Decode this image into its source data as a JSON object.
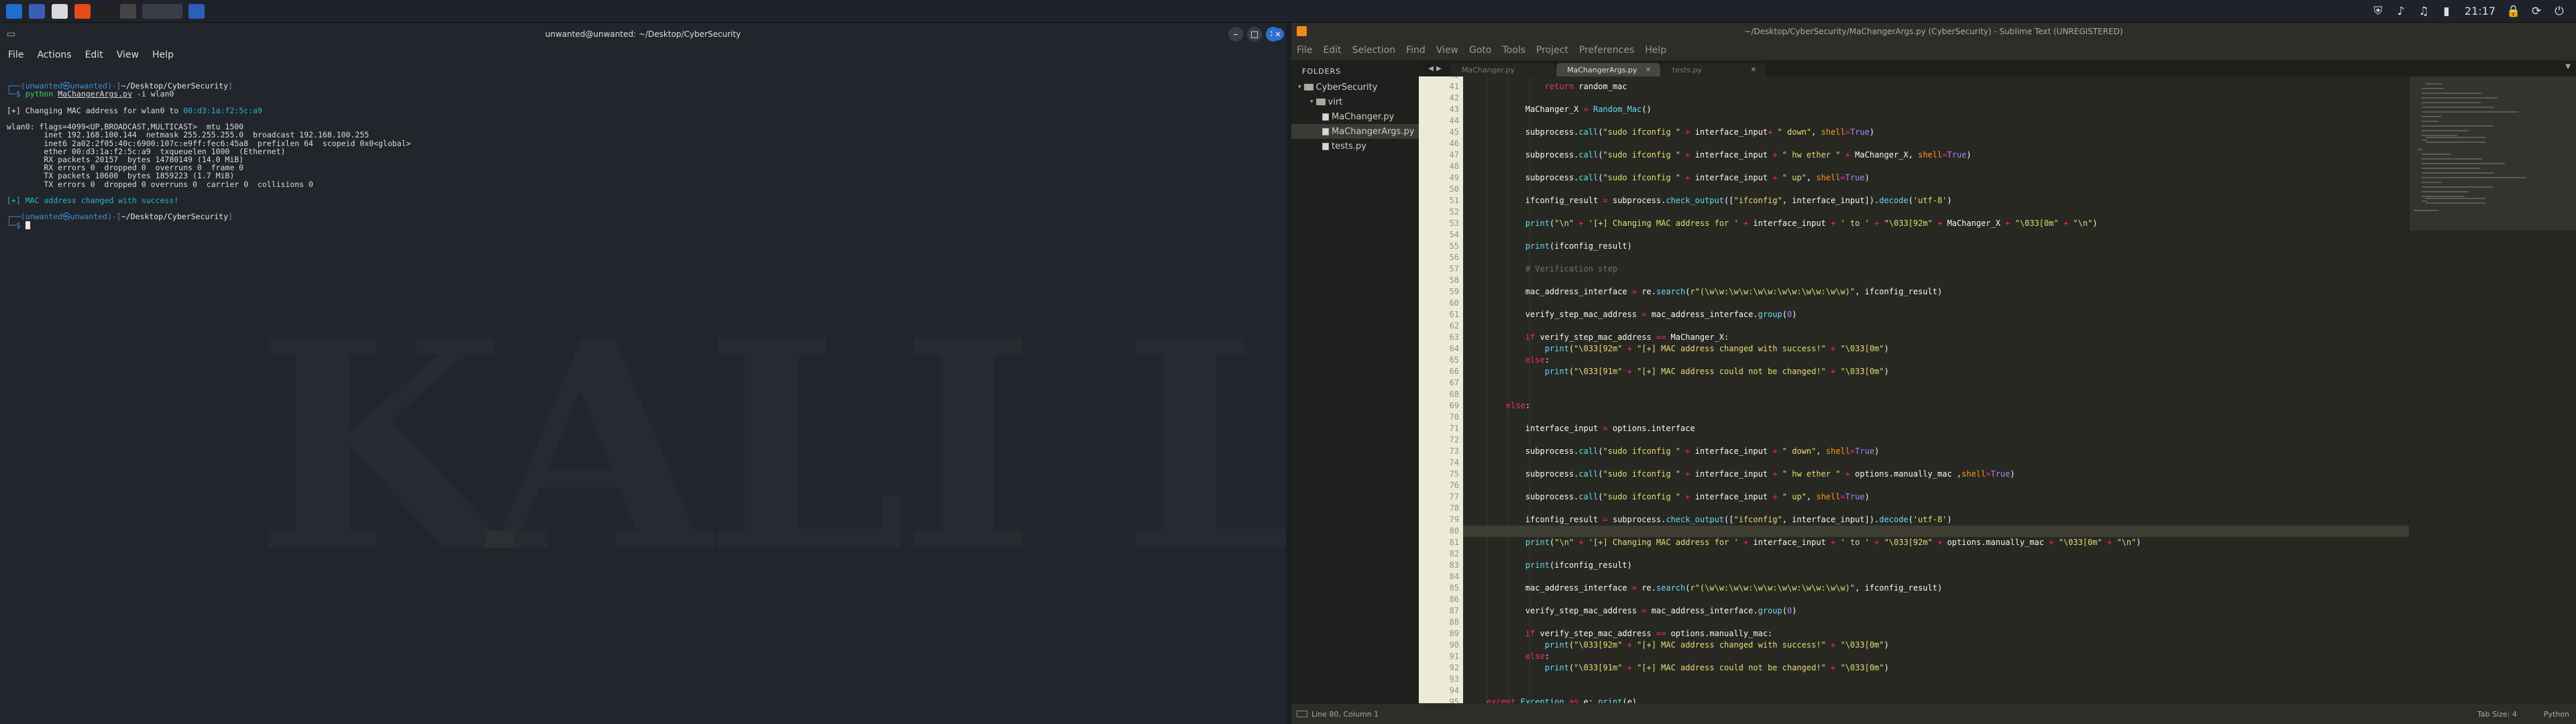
{
  "panel": {
    "apps": [
      {
        "name": "kali-menu-icon",
        "bg": "#1f6ecf"
      },
      {
        "name": "workspace-icon",
        "bg": "#3b5eb6"
      },
      {
        "name": "files-icon",
        "bg": "#d9d9d9"
      },
      {
        "name": "browser-icon",
        "bg": "#e64a19"
      },
      {
        "name": "terminal-icon",
        "bg": "#222"
      },
      {
        "name": "window-icon",
        "bg": "#444"
      },
      {
        "name": "active-terminal-icon",
        "bg": "#3a3d46"
      },
      {
        "name": "sublime-panel-icon",
        "bg": "#2b5fb8"
      }
    ],
    "tray": [
      "shield-icon",
      "volume-icon",
      "bell-icon",
      "battery-icon"
    ],
    "clock": "21:17",
    "tray2": [
      "lock-icon",
      "refresh-icon",
      "power-icon"
    ]
  },
  "terminal": {
    "title": "unwanted@unwanted: ~/Desktop/CyberSecurity",
    "menu": [
      "File",
      "Actions",
      "Edit",
      "View",
      "Help"
    ],
    "prompt_user": "(unwanted㉿unwanted)",
    "prompt_dir": "~/Desktop/CyberSecurity",
    "prompt_close": "]",
    "prompt_dollar": "$",
    "cmd_python": "python",
    "cmd_file": "MaChangerArgs.py",
    "cmd_args": "-i wlan0",
    "out_change_prefix": "[+] Changing MAC address for wlan0 to",
    "out_change_mac": "00:d3:1a:f2:5c:a9",
    "ifconfig": [
      "wlan0: flags=4099<UP,BROADCAST,MULTICAST>  mtu 1500",
      "        inet 192.168.100.144  netmask 255.255.255.0  broadcast 192.168.100.255",
      "        inet6 2a02:2f05:40c:6900:107c:e9ff:fec6:45a8  prefixlen 64  scopeid 0x0<global>",
      "        ether 00:d3:1a:f2:5c:a9  txqueuelen 1000  (Ethernet)",
      "        RX packets 20157  bytes 14780149 (14.0 MiB)",
      "        RX errors 0  dropped 0  overruns 0  frame 0",
      "        TX packets 10600  bytes 1859223 (1.7 MiB)",
      "        TX errors 0  dropped 0 overruns 0  carrier 0  collisions 0"
    ],
    "success": "[+] MAC address changed with success!",
    "watermark": "KALI LINUX"
  },
  "sublime": {
    "title": "~/Desktop/CyberSecurity/MaChangerArgs.py (CyberSecurity) - Sublime Text (UNREGISTERED)",
    "menu": [
      "File",
      "Edit",
      "Selection",
      "Find",
      "View",
      "Goto",
      "Tools",
      "Project",
      "Preferences",
      "Help"
    ],
    "folders_header": "FOLDERS",
    "tree": [
      {
        "label": "CyberSecurity",
        "type": "folder",
        "indent": 10,
        "sel": false
      },
      {
        "label": "virt",
        "type": "folder",
        "indent": 28,
        "sel": false
      },
      {
        "label": "MaChanger.py",
        "type": "file",
        "indent": 46,
        "sel": false
      },
      {
        "label": "MaChangerArgs.py",
        "type": "file",
        "indent": 46,
        "sel": true
      },
      {
        "label": "tests.py",
        "type": "file",
        "indent": 46,
        "sel": false
      }
    ],
    "tabs": [
      {
        "label": "MaChanger.py",
        "active": false,
        "close": ""
      },
      {
        "label": "MaChangerArgs.py",
        "active": true,
        "close": "✕"
      },
      {
        "label": "tests.py",
        "active": false,
        "close": "✕"
      }
    ],
    "status_left": "Line 80, Column 1",
    "tab_size": "Tab Size: 4",
    "syntax": "Python",
    "first_line": 40,
    "highlight_line": 80,
    "code": [
      "",
      "\t\t\t<k>return</k> random_mac",
      "",
      "\t\tMaChanger_X <k>=</k> <f>Random_Mac</f>()",
      "",
      "\t\tsubprocess.<f>call</f>(<s>\"sudo ifconfig \"</s> <k>+</k> interface_input<k>+</k> <s>\" down\"</s>, <o>shell</o><k>=</k><n>True</n>)",
      "",
      "\t\tsubprocess.<f>call</f>(<s>\"sudo ifconfig \"</s> <k>+</k> interface_input <k>+</k> <s>\" hw ether \"</s> <k>+</k> MaChanger_X, <o>shell</o><k>=</k><n>True</n>)",
      "",
      "\t\tsubprocess.<f>call</f>(<s>\"sudo ifconfig \"</s> <k>+</k> interface_input <k>+</k> <s>\" up\"</s>, <o>shell</o><k>=</k><n>True</n>)",
      "",
      "\t\tifconfig_result <k>=</k> subprocess.<f>check_output</f>([<s>\"ifconfig\"</s>, interface_input]).<f>decode</f>(<s>'utf-8'</s>)",
      "",
      "\t\t<f>print</f>(<s>\"\\n\"</s> <k>+</k> <s>'[+] Changing MAC address for '</s> <k>+</k> interface_input <k>+</k> <s>' to '</s> <k>+</k> <s>\"\\033[92m\"</s> <k>+</k> MaChanger_X <k>+</k> <s>\"\\033[0m\"</s> <k>+</k> <s>\"\\n\"</s>)",
      "",
      "\t\t<f>print</f>(ifconfig_result)",
      "",
      "\t\t<c># Verification step</c>",
      "",
      "\t\tmac_address_interface <k>=</k> re.<f>search</f>(<s>r\"(\\w\\w:\\w\\w:\\w\\w:\\w\\w:\\w\\w:\\w\\w)\"</s>, ifconfig_result)",
      "",
      "\t\tverify_step_mac_address <k>=</k> mac_address_interface.<f>group</f>(<n>0</n>)",
      "",
      "\t\t<k>if</k> verify_step_mac_address <k>==</k> MaChanger_X:",
      "\t\t\t<f>print</f>(<s>\"\\033[92m\"</s> <k>+</k> <s>\"[+] MAC address changed with success!\"</s> <k>+</k> <s>\"\\033[0m\"</s>)",
      "\t\t<k>else</k>:",
      "\t\t\t<f>print</f>(<s>\"\\033[91m\"</s> <k>+</k> <s>\"[+] MAC address could not be changed!\"</s> <k>+</k> <s>\"\\033[0m\"</s>)",
      "",
      "",
      "\t<k>else</k>:",
      "",
      "\t\tinterface_input <k>=</k> options.interface",
      "",
      "\t\tsubprocess.<f>call</f>(<s>\"sudo ifconfig \"</s> <k>+</k> interface_input <k>+</k> <s>\" down\"</s>, <o>shell</o><k>=</k><n>True</n>)",
      "",
      "\t\tsubprocess.<f>call</f>(<s>\"sudo ifconfig \"</s> <k>+</k> interface_input <k>+</k> <s>\" hw ether \"</s> <k>+</k> options.manually_mac ,<o>shell</o><k>=</k><n>True</n>)",
      "",
      "\t\tsubprocess.<f>call</f>(<s>\"sudo ifconfig \"</s> <k>+</k> interface_input <k>+</k> <s>\" up\"</s>, <o>shell</o><k>=</k><n>True</n>)",
      "",
      "\t\tifconfig_result <k>=</k> subprocess.<f>check_output</f>([<s>\"ifconfig\"</s>, interface_input]).<f>decode</f>(<s>'utf-8'</s>)",
      "",
      "\t\t<f>print</f>(<s>\"\\n\"</s> <k>+</k> <s>'[+] Changing MAC address for '</s> <k>+</k> interface_input <k>+</k> <s>' to '</s> <k>+</k> <s>\"\\033[92m\"</s> <k>+</k> options.manually_mac <k>+</k> <s>\"\\033[0m\"</s> <k>+</k> <s>\"\\n\"</s>)",
      "",
      "\t\t<f>print</f>(ifconfig_result)",
      "",
      "\t\tmac_address_interface <k>=</k> re.<f>search</f>(<s>r\"(\\w\\w:\\w\\w:\\w\\w:\\w\\w:\\w\\w:\\w\\w)\"</s>, ifconfig_result)",
      "",
      "\t\tverify_step_mac_address <k>=</k> mac_address_interface.<f>group</f>(<n>0</n>)",
      "",
      "\t\t<k>if</k> verify_step_mac_address <k>==</k> options.manually_mac:",
      "\t\t\t<f>print</f>(<s>\"\\033[92m\"</s> <k>+</k> <s>\"[+] MAC address changed with success!\"</s> <k>+</k> <s>\"\\033[0m\"</s>)",
      "\t\t<k>else</k>:",
      "\t\t\t<f>print</f>(<s>\"\\033[91m\"</s> <k>+</k> <s>\"[+] MAC address could not be changed!\"</s> <k>+</k> <s>\"\\033[0m\"</s>)",
      "",
      "",
      "<k>except</k> <f>Exception</f> <k>as</k> e: <f>print</f>(e)"
    ]
  }
}
